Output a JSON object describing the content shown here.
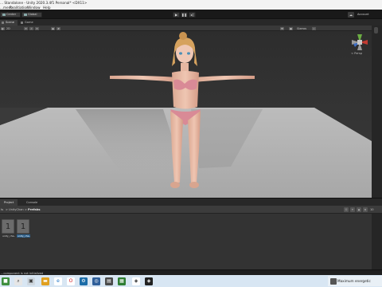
{
  "window": {
    "title": "... Standalone - Unity 2020.3.4f1 Personal* <DX11>"
  },
  "menu": {
    "items": [
      "...ment",
      "Realitiation",
      "Window",
      "Help"
    ]
  },
  "toolbar": {
    "center_label": "Center",
    "global_label": "Global",
    "account_label": "Account"
  },
  "scene_tabs": [
    {
      "label": "Scene"
    },
    {
      "label": "Game"
    }
  ],
  "scene_toolbar": {
    "shading_value": "2D",
    "gizmos_label": "Gizmos"
  },
  "scene_view": {
    "gizmo_view_label": "< Persp"
  },
  "bottom": {
    "tabs": [
      {
        "label": "Project"
      },
      {
        "label": "Console"
      }
    ],
    "breadcrumb": [
      "ts",
      ">",
      "UnityChan",
      ">",
      "Prefabs"
    ],
    "count_label": "10"
  },
  "project_assets": [
    {
      "name": "unity_cha...",
      "thumb_glyph": "1",
      "selected": false
    },
    {
      "name": "unity_cha...",
      "thumb_glyph": "1",
      "selected": true
    }
  ],
  "status": {
    "message": "...component is not initialized"
  },
  "taskbar": {
    "notification": "Maximum energetic"
  },
  "colors": {
    "editor_bg": "#1e1e1e",
    "selection": "#2c5d87",
    "taskbar": "#d8e6f3"
  }
}
